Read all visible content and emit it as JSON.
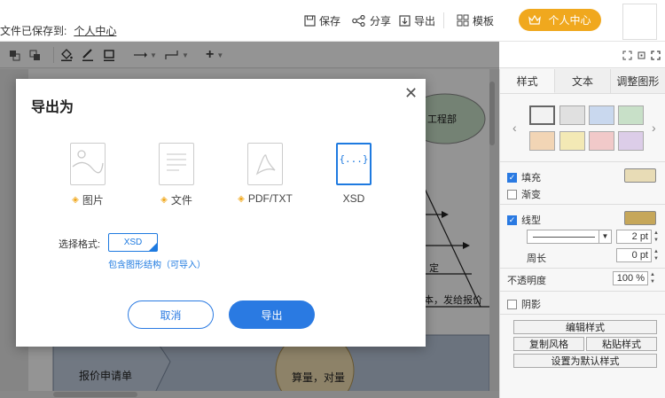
{
  "header": {
    "saved_label": "文件已保存到:",
    "saved_link": "个人中心",
    "save": "保存",
    "share": "分享",
    "export": "导出",
    "template": "模板",
    "personal_center": "个人中心"
  },
  "canvas": {
    "node_engineering": "工程部",
    "label_quote_send": "本，发给报价",
    "label_confirm": "定",
    "node_quote_form": "报价申请单",
    "node_calc": "算量，对量"
  },
  "panel": {
    "tabs": [
      "样式",
      "文本",
      "调整图形"
    ],
    "swatches": [
      "#f2f2f2",
      "#e0e0e0",
      "#c9d8ee",
      "#c8e0c8",
      "#f2d5b5",
      "#f3e9b5",
      "#f1c9c9",
      "#dccde8"
    ],
    "fill_label": "填充",
    "fill_color": "#e8dcb6",
    "gradient_label": "渐变",
    "line_label": "线型",
    "line_color": "#c6a75a",
    "line_width": "2 pt",
    "perimeter_label": "周长",
    "perimeter_value": "0 pt",
    "opacity_label": "不透明度",
    "opacity_value": "100 %",
    "shadow_label": "阴影",
    "edit_style": "编辑样式",
    "copy_style": "复制风格",
    "paste_style": "粘贴样式",
    "set_default": "设置为默认样式"
  },
  "dialog": {
    "title": "导出为",
    "options": [
      {
        "label": "图片",
        "premium": true
      },
      {
        "label": "文件",
        "premium": true
      },
      {
        "label": "PDF/TXT",
        "premium": true
      },
      {
        "label": "XSD",
        "premium": false
      }
    ],
    "xsd_icon_text": "{...}",
    "format_label": "选择格式:",
    "format_value": "XSD",
    "format_hint": "包含图形结构（可导入）",
    "cancel": "取消",
    "export": "导出"
  },
  "colors": {
    "accent": "#2a7ae2",
    "vip": "#f0a81e",
    "pdf_red": "#c9c9c9"
  }
}
